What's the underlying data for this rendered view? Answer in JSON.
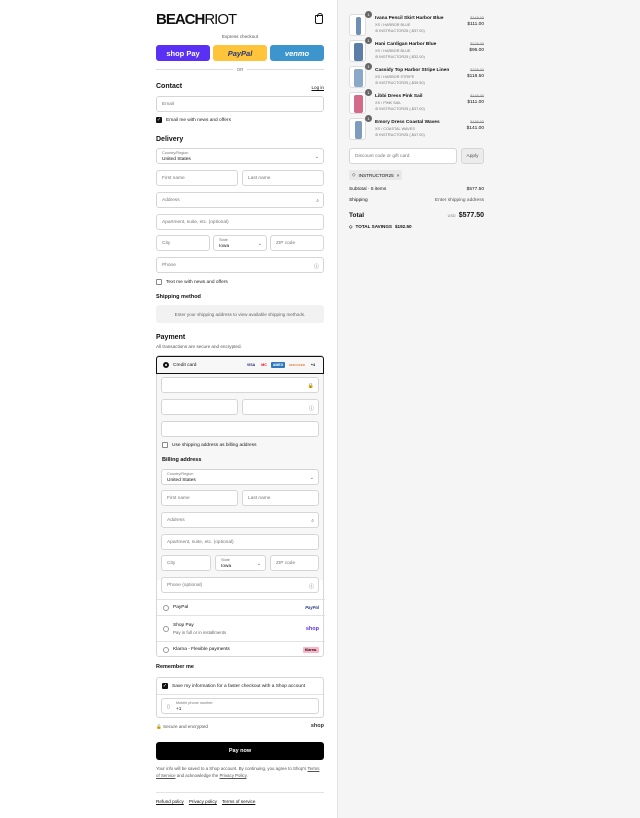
{
  "brand": {
    "name_bold": "BEACH",
    "name_thin": "RIOT"
  },
  "express": {
    "label": "Express checkout",
    "shop": "shop Pay",
    "paypal": "PayPal",
    "venmo": "venmo",
    "or": "OR"
  },
  "contact": {
    "title": "Contact",
    "login": "Log in",
    "email_placeholder": "Email",
    "news": "Email me with news and offers"
  },
  "delivery": {
    "title": "Delivery",
    "country_label": "Country/Region",
    "country": "United States",
    "first": "First name",
    "last": "Last name",
    "address": "Address",
    "apt": "Apartment, suite, etc. (optional)",
    "city": "City",
    "state_label": "State",
    "state": "Iowa",
    "zip": "ZIP code",
    "phone": "Phone",
    "text_news": "Text me with news and offers"
  },
  "shipping": {
    "title": "Shipping method",
    "notice": "Enter your shipping address to view available shipping methods."
  },
  "payment": {
    "title": "Payment",
    "subtitle": "All transactions are secure and encrypted.",
    "credit": "Credit card",
    "card_icons": [
      "VISA",
      "MC",
      "AMEX",
      "DISCOVER"
    ],
    "more": "+4",
    "use_shipping": "Use shipping address as billing address",
    "billing_title": "Billing address",
    "phone_opt": "Phone (optional)",
    "paypal": "PayPal",
    "paypal_logo": "PayPal",
    "shoppay": "Shop Pay",
    "shoppay_sub": "Pay in full or in installments",
    "shop_logo": "shop",
    "klarna": "Klarna - Flexible payments",
    "klarna_logo": "Klarna."
  },
  "remember": {
    "title": "Remember me",
    "save": "Save my information for a faster checkout with a Shop account",
    "mobile_label": "Mobile phone number",
    "mobile_value": "+1",
    "secure": "Secure and encrypted",
    "shop_logo": "shop"
  },
  "pay_now": "Pay now",
  "legal": {
    "line1": "Your info will be saved to a Shop account. By continuing, you agree to Shop's",
    "tos": "Terms of Service",
    "mid": "and acknowledge the",
    "privacy": "Privacy Policy",
    "end": "."
  },
  "footer": [
    "Refund policy",
    "Privacy policy",
    "Terms of service"
  ],
  "cart": {
    "items": [
      {
        "qty": "1",
        "name": "Ivana Pencil Skirt Harbor Blue",
        "variant": "XS / HARBOR BLUE",
        "code": "INSTRUCTOR25 (-$37.00)",
        "old": "$148.00",
        "price": "$111.00",
        "color": "#6f8fb4"
      },
      {
        "qty": "1",
        "name": "Hani Cardigan Harbor Blue",
        "variant": "XS / HARBOR BLUE",
        "code": "INSTRUCTOR25 (-$32.00)",
        "old": "$128.00",
        "price": "$96.00",
        "color": "#5a7ea8"
      },
      {
        "qty": "1",
        "name": "Cassidy Top Harbor Stripe Linen",
        "variant": "XS / HARBOR STRIPE",
        "code": "INSTRUCTOR25 (-$39.50)",
        "old": "$158.00",
        "price": "$118.50",
        "color": "#8aa9c9"
      },
      {
        "qty": "1",
        "name": "Libbi Dress Pink Sail",
        "variant": "XS / PINK SAIL",
        "code": "INSTRUCTOR25 (-$37.00)",
        "old": "$148.00",
        "price": "$111.00",
        "color": "#d46a8a"
      },
      {
        "qty": "1",
        "name": "Emory Dress Coastal Waves",
        "variant": "XS / COASTAL WAVES",
        "code": "INSTRUCTOR25 (-$47.00)",
        "old": "$188.00",
        "price": "$141.00",
        "color": "#7e9cbc"
      }
    ],
    "discount_placeholder": "Discount code or gift card",
    "apply": "Apply",
    "tag": "INSTRUCTOR25",
    "subtotal_label": "Subtotal · 5 items",
    "subtotal": "$577.50",
    "shipping_label": "Shipping",
    "shipping_value": "Enter shipping address",
    "total_label": "Total",
    "currency": "USD",
    "total": "$577.50",
    "savings_label": "TOTAL SAVINGS",
    "savings": "$192.50"
  }
}
